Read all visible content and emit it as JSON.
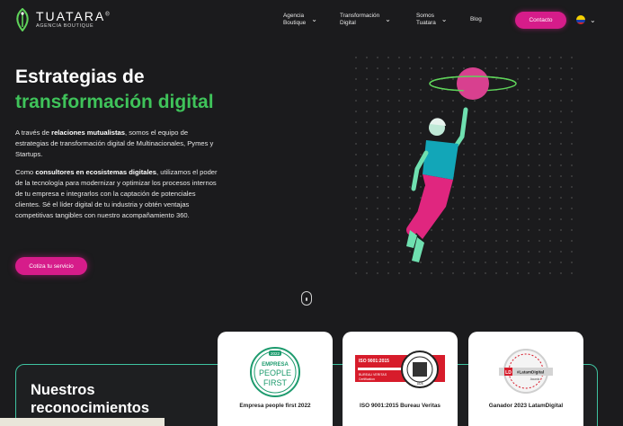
{
  "brand": {
    "name": "TUATARA",
    "registered": "®",
    "subtitle": "AGENCIA BOUTIQUE"
  },
  "nav": {
    "items": [
      {
        "label_l1": "Agencia",
        "label_l2": "Boutique",
        "has_dropdown": true
      },
      {
        "label_l1": "Transformación",
        "label_l2": "Digital",
        "has_dropdown": true
      },
      {
        "label_l1": "Somos",
        "label_l2": "Tuatara",
        "has_dropdown": true
      },
      {
        "label_l1": "Blog",
        "label_l2": "",
        "has_dropdown": false
      }
    ],
    "contact_label": "Contacto",
    "language_flag": "colombia-flag-icon"
  },
  "hero": {
    "title_line1": "Estrategias de",
    "title_line2": "transformación digital",
    "p1_pre": "A través de ",
    "p1_bold": "relaciones mutualistas",
    "p1_post": ", somos el equipo de estrategias de transformación digital de Multinacionales, Pymes y Startups.",
    "p2_pre": "Como ",
    "p2_bold": "consultores en ecosistemas digitales",
    "p2_post": ", utilizamos el poder de la tecnología para modernizar y optimizar los procesos internos de tu empresa e integrarlos con la captación de potenciales clientes. Sé el líder digital de tu industria y obtén ventajas competitivas tangibles con nuestro acompañamiento 360.",
    "cta_label": "Cotiza tu servicio"
  },
  "recognitions": {
    "title_l1": "Nuestros",
    "title_l2": "reconocimientos",
    "awards": [
      {
        "label": "Empresa people first 2022",
        "badge_lines": [
          "2022",
          "EMPRESA",
          "PEOPLE",
          "FIRST"
        ]
      },
      {
        "label": "ISO 9001:2015 Bureau Veritas",
        "badge_lines": [
          "ISO 9001:2015",
          "BUREAU VERITAS",
          "Certification",
          "1828"
        ]
      },
      {
        "label": "Ganador 2023 LatamDigital",
        "badge_lines": [
          "LD",
          "#LatamDigital",
          "Awards"
        ]
      }
    ]
  },
  "colors": {
    "accent_pink": "#d61c8a",
    "accent_green": "#3fc35a",
    "background": "#1b1b1d",
    "teal_border": "#3fc3a0"
  }
}
